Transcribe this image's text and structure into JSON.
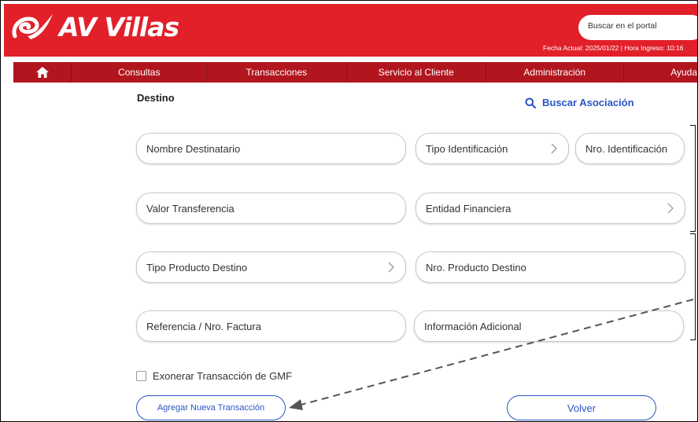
{
  "header": {
    "logo_text": "AV Villas",
    "search_placeholder": "Buscar en el portal",
    "date_line": "Fecha Actual: 2025/01/22 | Hora Ingreso: 10:16",
    "brand_color": "#e2202a"
  },
  "nav": {
    "home_icon": "home-icon",
    "items": [
      "Consultas",
      "Transacciones",
      "Servicio al Cliente",
      "Administración",
      "Ayuda"
    ]
  },
  "form": {
    "section_title": "Destino",
    "assoc_link": "Buscar Asociación",
    "fields": {
      "nombre": "Nombre Destinatario",
      "tipo_id": "Tipo Identificación",
      "nro_id": "Nro. Identificación",
      "valor": "Valor Transferencia",
      "entidad": "Entidad Financiera",
      "tipo_producto": "Tipo Producto Destino",
      "nro_producto": "Nro. Producto Destino",
      "referencia": "Referencia / Nro. Factura",
      "info_adicional": "Información Adicional"
    },
    "gmf_label": "Exonerar Transacción de GMF",
    "gmf_checked": false,
    "add_button": "Agregar Nueva Transacción",
    "back_button": "Volver"
  }
}
